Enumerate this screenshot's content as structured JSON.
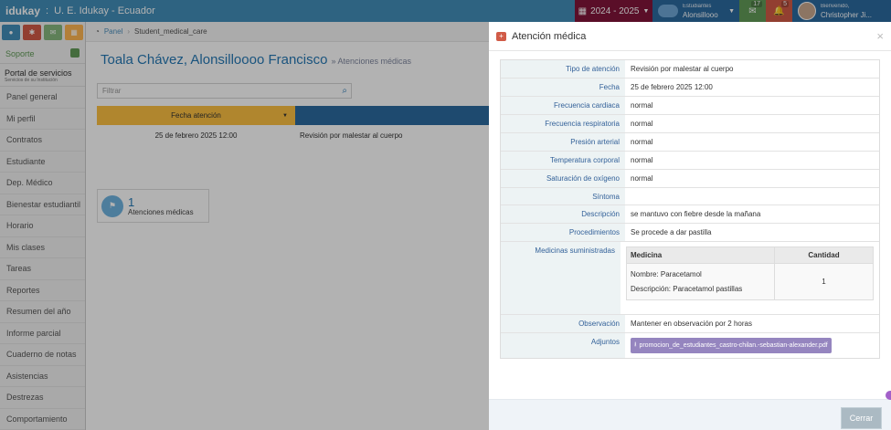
{
  "header": {
    "logo": "idukay",
    "separator": ":",
    "school": "U. E. Idukay - Ecuador",
    "period": "2024 - 2025",
    "student_label": "Estudiantes",
    "student_name": "Alonsillooo",
    "messages_count": "17",
    "alerts_count": "5",
    "welcome": "Bienvenido,",
    "user_name": "Christopher Ji..."
  },
  "sidebar": {
    "support": "Soporte",
    "portal_title": "Portal de servicios",
    "portal_subtitle": "Servicios de su Institución",
    "items": [
      {
        "label": "Panel general"
      },
      {
        "label": "Mi perfil"
      },
      {
        "label": "Contratos"
      },
      {
        "label": "Estudiante"
      },
      {
        "label": "Dep. Médico"
      },
      {
        "label": "Bienestar estudiantil"
      },
      {
        "label": "Horario"
      },
      {
        "label": "Mis clases"
      },
      {
        "label": "Tareas"
      },
      {
        "label": "Reportes"
      },
      {
        "label": "Resumen del año"
      },
      {
        "label": "Informe parcial"
      },
      {
        "label": "Cuaderno de notas"
      },
      {
        "label": "Asistencias"
      },
      {
        "label": "Destrezas"
      },
      {
        "label": "Comportamiento"
      }
    ]
  },
  "breadcrumb": {
    "home": "Panel",
    "current": "Student_medical_care"
  },
  "page": {
    "title": "Toala Chávez, Alonsilloooo Francisco",
    "subtitle": "» Atenciones médicas",
    "filter_placeholder": "Filtrar",
    "col_date": "Fecha atención",
    "row_date": "25 de febrero 2025 12:00",
    "row_type": "Revisión por malestar al cuerpo",
    "stat_number": "1",
    "stat_label": "Atenciones médicas"
  },
  "modal": {
    "title": "Atención médica",
    "close_icon": "×",
    "fields": {
      "tipo_label": "Tipo de atención",
      "tipo": "Revisión por malestar al cuerpo",
      "fecha_label": "Fecha",
      "fecha": "25 de febrero 2025 12:00",
      "fc_label": "Frecuencia cardiaca",
      "fc": "normal",
      "fr_label": "Frecuencia respiratoria",
      "fr": "normal",
      "pa_label": "Presión arterial",
      "pa": "normal",
      "temp_label": "Temperatura corporal",
      "temp": "normal",
      "sat_label": "Saturación de oxígeno",
      "sat": "normal",
      "sint_label": "Síntoma",
      "sint": "",
      "desc_label": "Descripción",
      "desc": "se mantuvo con fiebre desde la mañana",
      "proc_label": "Procedimientos",
      "proc": "Se procede a dar pastilla",
      "med_label": "Medicinas suministradas",
      "obs_label": "Observación",
      "obs": "Mantener en observación por 2 horas",
      "adj_label": "Adjuntos",
      "adj": "promocion_de_estudiantes_castro-chilan.-sebastian-alexander.pdf"
    },
    "medicines": {
      "col_med": "Medicina",
      "col_qty": "Cantidad",
      "name": "Nombre: Paracetamol",
      "description": "Descripción: Paracetamol pastillas",
      "qty": "1"
    },
    "close_button": "Cerrar"
  },
  "colors": {
    "topbar": "#438eb9",
    "period": "#82153a",
    "accent": "#2679b5",
    "table_header": "#fcc143",
    "attachment": "#9585bf"
  }
}
